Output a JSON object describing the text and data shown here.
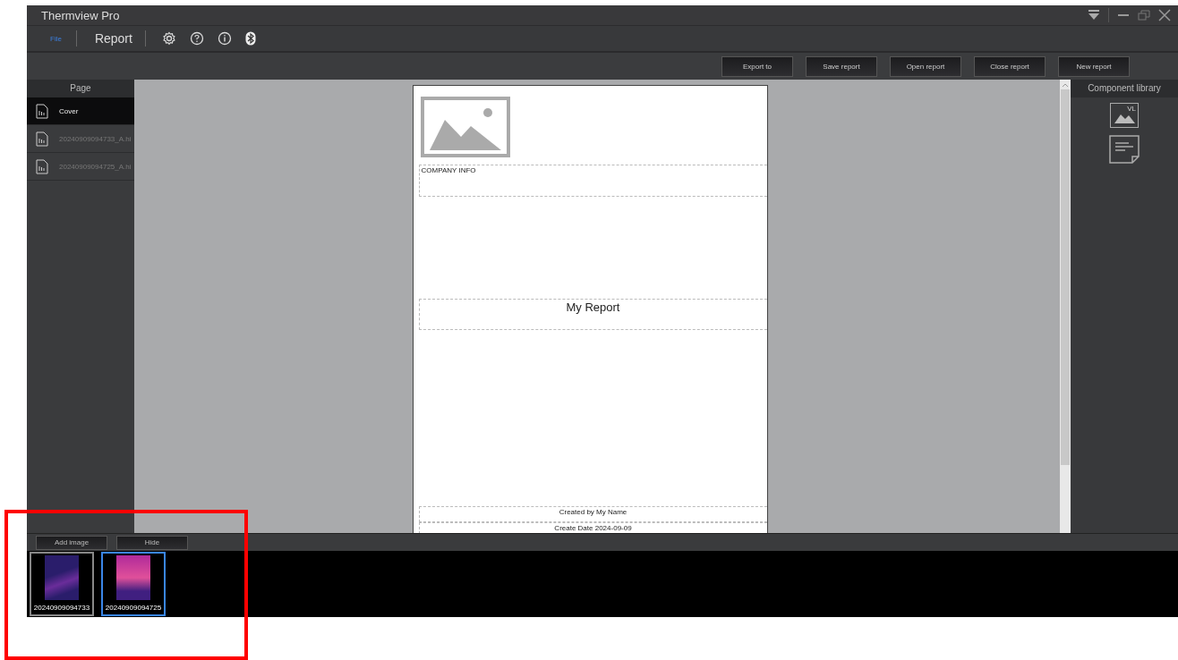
{
  "window": {
    "title": "Thermview Pro"
  },
  "menu": [
    {
      "label": "File",
      "selected": false
    },
    {
      "label": "Report",
      "selected": true
    }
  ],
  "toolbar_buttons": [
    "Export to",
    "Save report",
    "Open report",
    "Close report",
    "New report"
  ],
  "pages_panel": {
    "title": "Page",
    "items": [
      {
        "label": "Cover",
        "selected": true
      },
      {
        "label": "20240909094733_A.hi",
        "selected": false
      },
      {
        "label": "20240909094725_A.hi",
        "selected": false
      }
    ]
  },
  "report_page": {
    "company_info": "COMPANY INFO",
    "title": "My Report",
    "created_by": "Created by My Name",
    "create_date": "Create Date 2024-09-09"
  },
  "component_library": {
    "title": "Component library",
    "items": [
      {
        "kind": "image",
        "badge": "VL"
      },
      {
        "kind": "text"
      }
    ]
  },
  "image_bar": {
    "buttons": [
      "Add image",
      "Hide"
    ],
    "thumbnails": [
      {
        "caption": "20240909094733",
        "selected": false
      },
      {
        "caption": "20240909094725",
        "selected": true
      }
    ]
  }
}
